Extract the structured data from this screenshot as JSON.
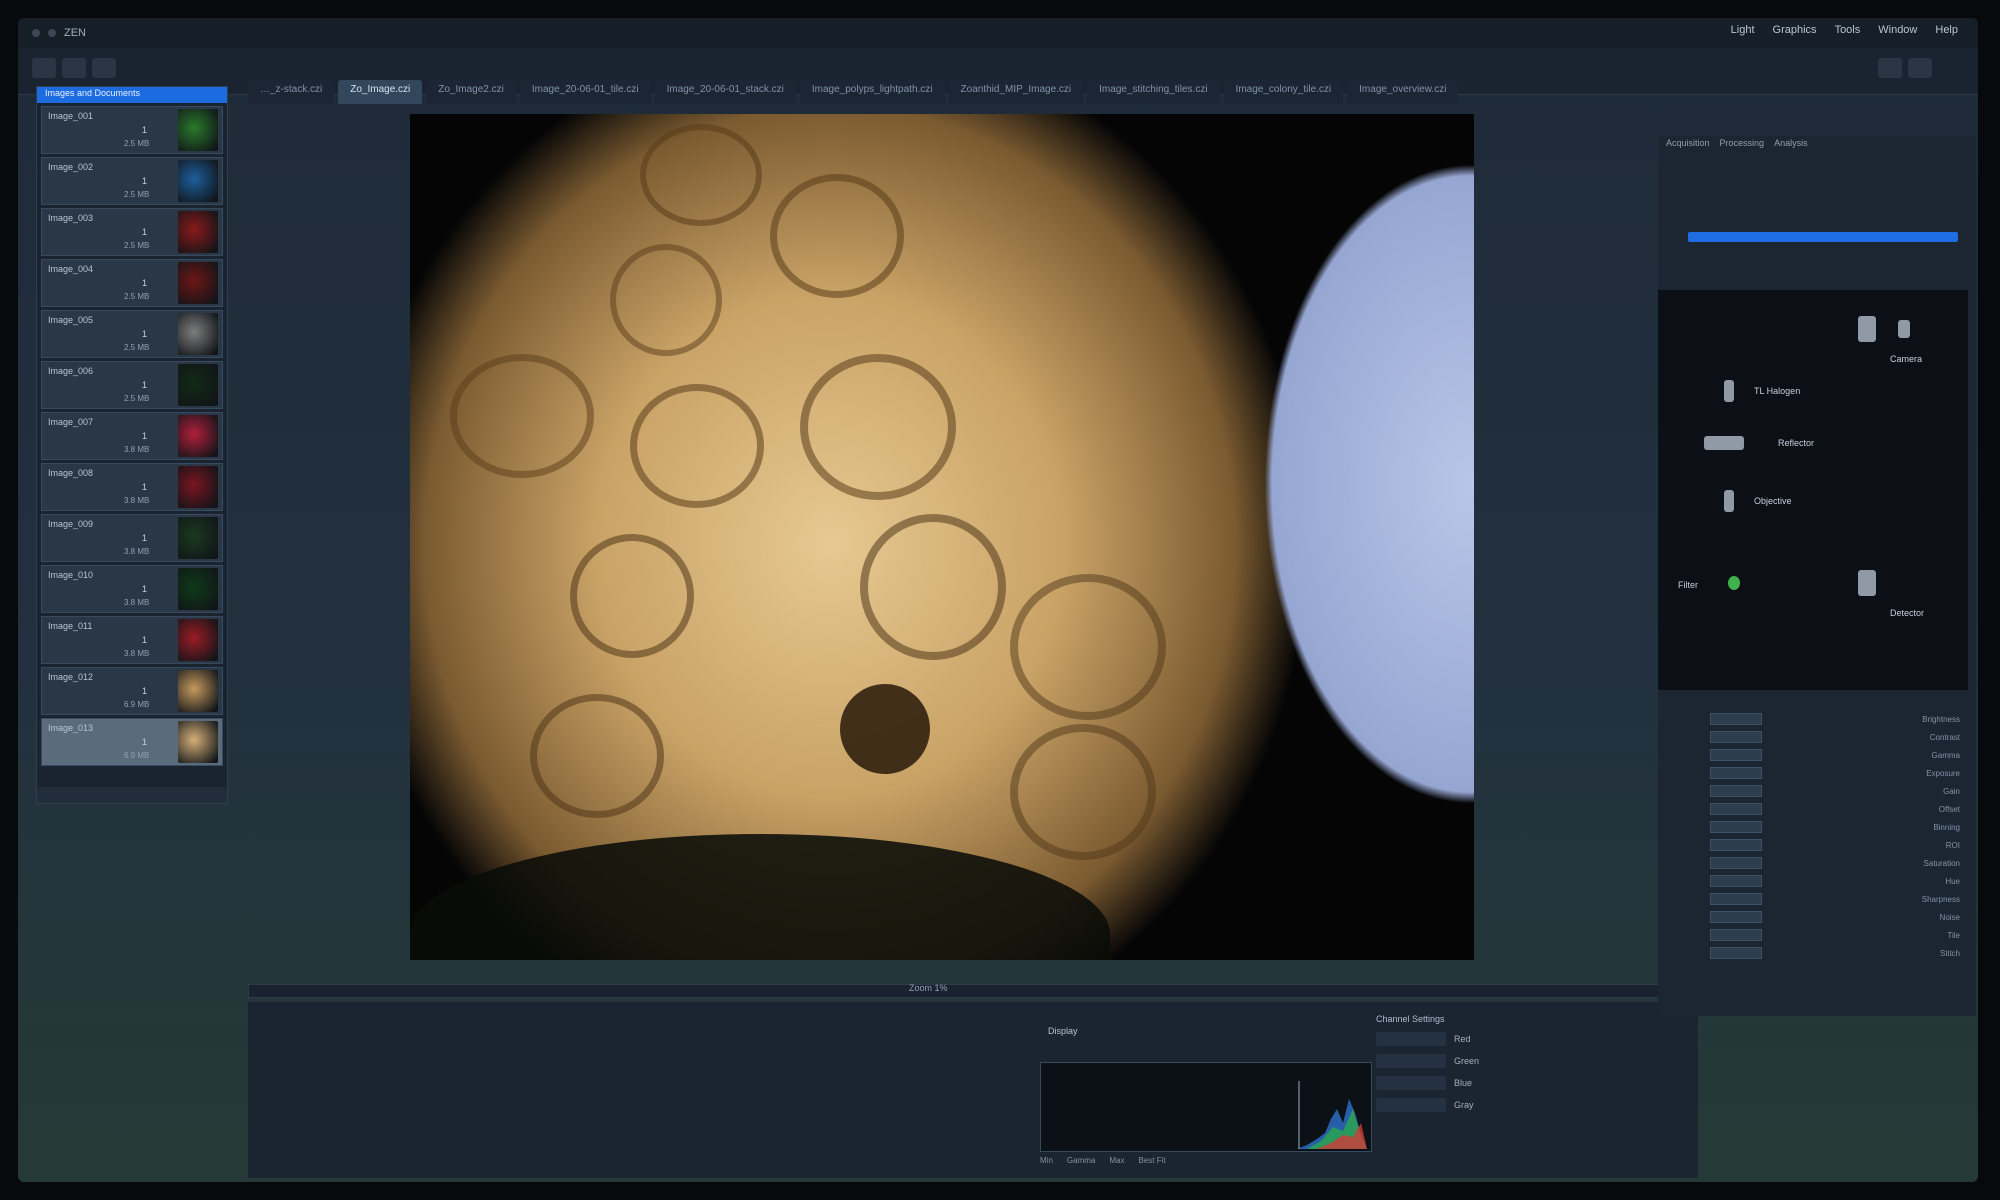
{
  "app": {
    "title": "ZEN",
    "menu": [
      "Light",
      "Graphics",
      "Tools",
      "Window",
      "Help"
    ]
  },
  "doc_tabs": [
    {
      "label": "…_z-stack.czi",
      "active": false
    },
    {
      "label": "Zo_Image.czi",
      "active": true
    },
    {
      "label": "Zo_Image2.czi",
      "active": false
    },
    {
      "label": "Image_20-06-01_tile.czi",
      "active": false
    },
    {
      "label": "Image_20-06-01_stack.czi",
      "active": false
    },
    {
      "label": "Image_polyps_lightpath.czi",
      "active": false
    },
    {
      "label": "Zoanthid_MIP_Image.czi",
      "active": false
    },
    {
      "label": "Image_stitching_tiles.czi",
      "active": false
    },
    {
      "label": "Image_colony_tile.czi",
      "active": false
    },
    {
      "label": "Image_overview.czi",
      "active": false
    }
  ],
  "gallery": {
    "header": "Images and Documents",
    "items": [
      {
        "label": "Image_001",
        "num": "1",
        "size": "2.5 MB",
        "color": "#2a7a2a"
      },
      {
        "label": "Image_002",
        "num": "1",
        "size": "2.5 MB",
        "color": "#1e5f9c"
      },
      {
        "label": "Image_003",
        "num": "1",
        "size": "2.5 MB",
        "color": "#8a1a1a"
      },
      {
        "label": "Image_004",
        "num": "1",
        "size": "2.5 MB",
        "color": "#6d1616"
      },
      {
        "label": "Image_005",
        "num": "1",
        "size": "2.5 MB",
        "color": "#7d7d7d"
      },
      {
        "label": "Image_006",
        "num": "1",
        "size": "2.5 MB",
        "color": "#122a16"
      },
      {
        "label": "Image_007",
        "num": "1",
        "size": "3.8 MB",
        "color": "#b01f3a"
      },
      {
        "label": "Image_008",
        "num": "1",
        "size": "3.8 MB",
        "color": "#7a1420"
      },
      {
        "label": "Image_009",
        "num": "1",
        "size": "3.8 MB",
        "color": "#1b3a1f"
      },
      {
        "label": "Image_010",
        "num": "1",
        "size": "3.8 MB",
        "color": "#0f3a18"
      },
      {
        "label": "Image_011",
        "num": "1",
        "size": "3.8 MB",
        "color": "#9a1c24"
      },
      {
        "label": "Image_012",
        "num": "1",
        "size": "6.9 MB",
        "color": "#c79a5e"
      },
      {
        "label": "Image_013",
        "num": "1",
        "size": "6.9 MB",
        "color": "#d6b078"
      }
    ]
  },
  "viewer": {
    "timeline_label": "Zoom 1%"
  },
  "histogram": {
    "header": "Display",
    "ctrls": [
      "Min",
      "Gamma",
      "Max",
      "Best Fit"
    ]
  },
  "display_settings": {
    "label": "Channel Settings",
    "rows": [
      "Red",
      "Green",
      "Blue",
      "Gray"
    ]
  },
  "right_panel": {
    "tabs": [
      "Acquisition",
      "Processing",
      "Analysis"
    ],
    "lightpath": {
      "items": [
        "TL Halogen",
        "Reflector",
        "Camera",
        "Objective",
        "Filter",
        "Detector"
      ]
    },
    "channels": [
      {
        "name": "Brightness"
      },
      {
        "name": "Contrast"
      },
      {
        "name": "Gamma"
      },
      {
        "name": "Exposure"
      },
      {
        "name": "Gain"
      },
      {
        "name": "Offset"
      },
      {
        "name": "Binning"
      },
      {
        "name": "ROI"
      },
      {
        "name": "Saturation"
      },
      {
        "name": "Hue"
      },
      {
        "name": "Sharpness"
      },
      {
        "name": "Noise"
      },
      {
        "name": "Tile"
      },
      {
        "name": "Stitch"
      }
    ]
  }
}
